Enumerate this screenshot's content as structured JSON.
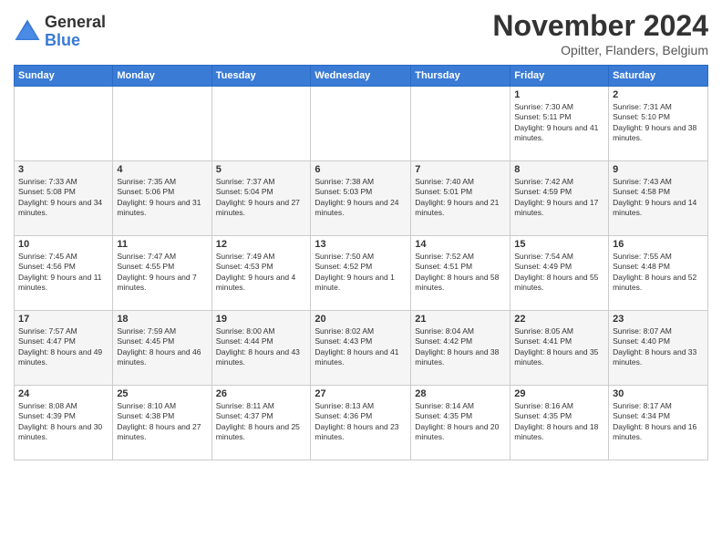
{
  "logo": {
    "general": "General",
    "blue": "Blue"
  },
  "title": "November 2024",
  "location": "Opitter, Flanders, Belgium",
  "days_header": [
    "Sunday",
    "Monday",
    "Tuesday",
    "Wednesday",
    "Thursday",
    "Friday",
    "Saturday"
  ],
  "weeks": [
    [
      {
        "day": "",
        "info": ""
      },
      {
        "day": "",
        "info": ""
      },
      {
        "day": "",
        "info": ""
      },
      {
        "day": "",
        "info": ""
      },
      {
        "day": "",
        "info": ""
      },
      {
        "day": "1",
        "info": "Sunrise: 7:30 AM\nSunset: 5:11 PM\nDaylight: 9 hours and 41 minutes."
      },
      {
        "day": "2",
        "info": "Sunrise: 7:31 AM\nSunset: 5:10 PM\nDaylight: 9 hours and 38 minutes."
      }
    ],
    [
      {
        "day": "3",
        "info": "Sunrise: 7:33 AM\nSunset: 5:08 PM\nDaylight: 9 hours and 34 minutes."
      },
      {
        "day": "4",
        "info": "Sunrise: 7:35 AM\nSunset: 5:06 PM\nDaylight: 9 hours and 31 minutes."
      },
      {
        "day": "5",
        "info": "Sunrise: 7:37 AM\nSunset: 5:04 PM\nDaylight: 9 hours and 27 minutes."
      },
      {
        "day": "6",
        "info": "Sunrise: 7:38 AM\nSunset: 5:03 PM\nDaylight: 9 hours and 24 minutes."
      },
      {
        "day": "7",
        "info": "Sunrise: 7:40 AM\nSunset: 5:01 PM\nDaylight: 9 hours and 21 minutes."
      },
      {
        "day": "8",
        "info": "Sunrise: 7:42 AM\nSunset: 4:59 PM\nDaylight: 9 hours and 17 minutes."
      },
      {
        "day": "9",
        "info": "Sunrise: 7:43 AM\nSunset: 4:58 PM\nDaylight: 9 hours and 14 minutes."
      }
    ],
    [
      {
        "day": "10",
        "info": "Sunrise: 7:45 AM\nSunset: 4:56 PM\nDaylight: 9 hours and 11 minutes."
      },
      {
        "day": "11",
        "info": "Sunrise: 7:47 AM\nSunset: 4:55 PM\nDaylight: 9 hours and 7 minutes."
      },
      {
        "day": "12",
        "info": "Sunrise: 7:49 AM\nSunset: 4:53 PM\nDaylight: 9 hours and 4 minutes."
      },
      {
        "day": "13",
        "info": "Sunrise: 7:50 AM\nSunset: 4:52 PM\nDaylight: 9 hours and 1 minute."
      },
      {
        "day": "14",
        "info": "Sunrise: 7:52 AM\nSunset: 4:51 PM\nDaylight: 8 hours and 58 minutes."
      },
      {
        "day": "15",
        "info": "Sunrise: 7:54 AM\nSunset: 4:49 PM\nDaylight: 8 hours and 55 minutes."
      },
      {
        "day": "16",
        "info": "Sunrise: 7:55 AM\nSunset: 4:48 PM\nDaylight: 8 hours and 52 minutes."
      }
    ],
    [
      {
        "day": "17",
        "info": "Sunrise: 7:57 AM\nSunset: 4:47 PM\nDaylight: 8 hours and 49 minutes."
      },
      {
        "day": "18",
        "info": "Sunrise: 7:59 AM\nSunset: 4:45 PM\nDaylight: 8 hours and 46 minutes."
      },
      {
        "day": "19",
        "info": "Sunrise: 8:00 AM\nSunset: 4:44 PM\nDaylight: 8 hours and 43 minutes."
      },
      {
        "day": "20",
        "info": "Sunrise: 8:02 AM\nSunset: 4:43 PM\nDaylight: 8 hours and 41 minutes."
      },
      {
        "day": "21",
        "info": "Sunrise: 8:04 AM\nSunset: 4:42 PM\nDaylight: 8 hours and 38 minutes."
      },
      {
        "day": "22",
        "info": "Sunrise: 8:05 AM\nSunset: 4:41 PM\nDaylight: 8 hours and 35 minutes."
      },
      {
        "day": "23",
        "info": "Sunrise: 8:07 AM\nSunset: 4:40 PM\nDaylight: 8 hours and 33 minutes."
      }
    ],
    [
      {
        "day": "24",
        "info": "Sunrise: 8:08 AM\nSunset: 4:39 PM\nDaylight: 8 hours and 30 minutes."
      },
      {
        "day": "25",
        "info": "Sunrise: 8:10 AM\nSunset: 4:38 PM\nDaylight: 8 hours and 27 minutes."
      },
      {
        "day": "26",
        "info": "Sunrise: 8:11 AM\nSunset: 4:37 PM\nDaylight: 8 hours and 25 minutes."
      },
      {
        "day": "27",
        "info": "Sunrise: 8:13 AM\nSunset: 4:36 PM\nDaylight: 8 hours and 23 minutes."
      },
      {
        "day": "28",
        "info": "Sunrise: 8:14 AM\nSunset: 4:35 PM\nDaylight: 8 hours and 20 minutes."
      },
      {
        "day": "29",
        "info": "Sunrise: 8:16 AM\nSunset: 4:35 PM\nDaylight: 8 hours and 18 minutes."
      },
      {
        "day": "30",
        "info": "Sunrise: 8:17 AM\nSunset: 4:34 PM\nDaylight: 8 hours and 16 minutes."
      }
    ]
  ]
}
